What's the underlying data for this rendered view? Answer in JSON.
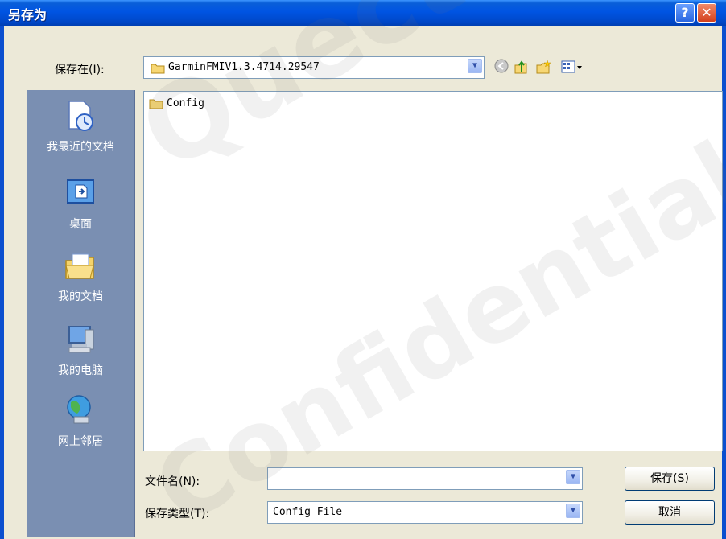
{
  "dialog": {
    "title": "另存为",
    "help_label": "?",
    "close_label": "✕"
  },
  "save_in": {
    "label": "保存在(I):",
    "value": "GarminFMIV1.3.4714.29547"
  },
  "toolbar": {
    "icons": [
      "back-icon",
      "up-folder-icon",
      "new-folder-icon",
      "view-menu-icon"
    ]
  },
  "places": [
    {
      "label": "我最近的文档",
      "icon": "recent-documents-icon"
    },
    {
      "label": "桌面",
      "icon": "desktop-icon"
    },
    {
      "label": "我的文档",
      "icon": "my-documents-icon"
    },
    {
      "label": "我的电脑",
      "icon": "my-computer-icon"
    },
    {
      "label": "网上邻居",
      "icon": "network-places-icon"
    }
  ],
  "files": [
    {
      "name": "Config",
      "icon": "folder-icon"
    }
  ],
  "filename": {
    "label": "文件名(N):",
    "value": ""
  },
  "filetype": {
    "label": "保存类型(T):",
    "value": "Config File"
  },
  "buttons": {
    "save": "保存(S)",
    "cancel": "取消"
  },
  "watermark": {
    "line1": "Quectel",
    "line2": "Confidential"
  },
  "colors": {
    "titlebar": "#0054e3",
    "dialog_bg": "#ece9d8",
    "places_bar": "#7a8fb2"
  }
}
